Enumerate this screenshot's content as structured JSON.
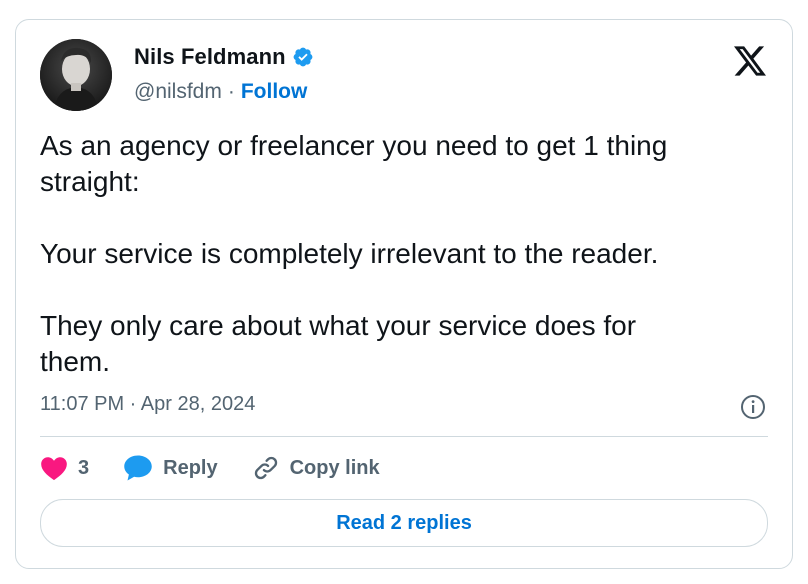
{
  "author": {
    "name": "Nils Feldmann",
    "handle": "@nilsfdm",
    "separator": "·",
    "follow_label": "Follow",
    "verified_color": "#1d9bf0"
  },
  "tweet": {
    "text": "As an agency or freelancer you need to get 1 thing\nstraight:\n\nYour service is completely irrelevant to the reader.\n\nThey only care about what your service does for\nthem.",
    "timestamp": "11:07 PM · Apr 28, 2024"
  },
  "actions": {
    "likes_count": "3",
    "reply_label": "Reply",
    "copy_link_label": "Copy link"
  },
  "footer": {
    "read_replies_label": "Read 2 replies"
  },
  "icons": [
    "x-logo-icon",
    "verified-badge-icon",
    "info-icon",
    "heart-icon",
    "reply-bubble-icon",
    "link-icon"
  ],
  "colors": {
    "heart": "#f91880",
    "reply_bubble": "#1d9bf0",
    "link_blue": "#0074d4",
    "muted": "#536471",
    "border": "#cfd9de"
  }
}
